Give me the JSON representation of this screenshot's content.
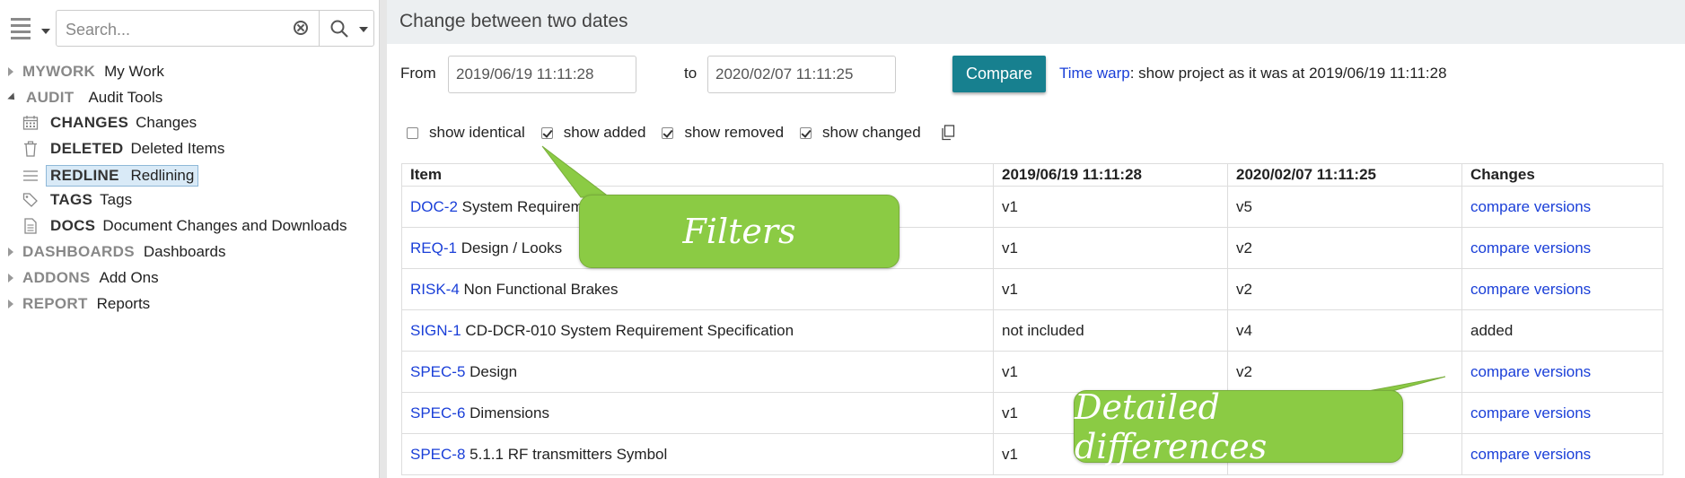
{
  "search": {
    "placeholder": "Search..."
  },
  "tree": {
    "mywork": {
      "code": "MYWORK",
      "label": "My Work"
    },
    "audit": {
      "code": "AUDIT",
      "label": "Audit Tools",
      "children": [
        {
          "code": "CHANGES",
          "label": "Changes",
          "icon": "calendar-icon"
        },
        {
          "code": "DELETED",
          "label": "Deleted Items",
          "icon": "trash-icon"
        },
        {
          "code": "REDLINE",
          "label": "Redlining",
          "icon": "list-lines-icon",
          "selected": true
        },
        {
          "code": "TAGS",
          "label": "Tags",
          "icon": "tag-icon"
        },
        {
          "code": "DOCS",
          "label": "Document Changes and Downloads",
          "icon": "document-icon"
        }
      ]
    },
    "dashboards": {
      "code": "DASHBOARDS",
      "label": "Dashboards"
    },
    "addons": {
      "code": "ADDONS",
      "label": "Add Ons"
    },
    "report": {
      "code": "REPORT",
      "label": "Reports"
    }
  },
  "main": {
    "title": "Change between two dates",
    "from_label": "From",
    "from_value": "2019/06/19 11:11:28",
    "to_label": "to",
    "to_value": "2020/02/07 11:11:25",
    "compare_label": "Compare",
    "timewarp_link": "Time warp",
    "timewarp_text": ": show project as it was at 2019/06/19 11:11:28",
    "filters": [
      {
        "label": "show identical",
        "checked": false
      },
      {
        "label": "show added",
        "checked": true
      },
      {
        "label": "show removed",
        "checked": true
      },
      {
        "label": "show changed",
        "checked": true
      }
    ]
  },
  "table": {
    "headers": [
      "Item",
      "2019/06/19 11:11:28",
      "2020/02/07 11:11:25",
      "Changes"
    ],
    "rows": [
      {
        "id": "DOC-2",
        "title": "System Requirements",
        "from": "v1",
        "to": "v5",
        "change": "compare versions",
        "change_link": true
      },
      {
        "id": "REQ-1",
        "title": "Design / Looks",
        "from": "v1",
        "to": "v2",
        "change": "compare versions",
        "change_link": true
      },
      {
        "id": "RISK-4",
        "title": "Non Functional Brakes",
        "from": "v1",
        "to": "v2",
        "change": "compare versions",
        "change_link": true
      },
      {
        "id": "SIGN-1",
        "title": "CD-DCR-010 System Requirement Specification",
        "from": "not included",
        "to": "v4",
        "change": "added",
        "change_link": false
      },
      {
        "id": "SPEC-5",
        "title": "Design",
        "from": "v1",
        "to": "v2",
        "change": "compare versions",
        "change_link": true
      },
      {
        "id": "SPEC-6",
        "title": "Dimensions",
        "from": "v1",
        "to": "",
        "change": "compare versions",
        "change_link": true
      },
      {
        "id": "SPEC-8",
        "title": "5.1.1 RF transmitters Symbol",
        "from": "v1",
        "to": "",
        "change": "compare versions",
        "change_link": true
      }
    ]
  },
  "callouts": {
    "filters": "Filters",
    "details": "Detailed differences"
  },
  "colors": {
    "accent": "#17808f",
    "link": "#1a3fd8",
    "callout": "#8bcb44"
  }
}
